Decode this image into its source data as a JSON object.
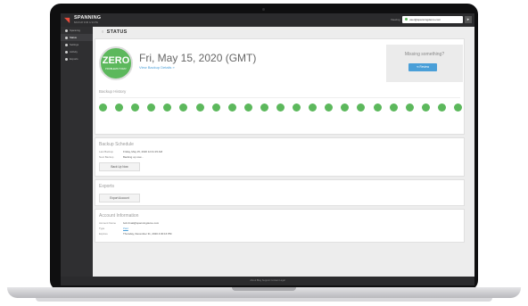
{
  "app": {
    "brand": "SPANNING",
    "brand_sub": "BACKUP FOR G SUITE",
    "account_label": "Viewing",
    "account_value": "user@spanningdemo.com"
  },
  "sidebar": {
    "items": [
      {
        "label": "Spanning",
        "active": false
      },
      {
        "label": "Status",
        "active": true
      },
      {
        "label": "Settings",
        "active": false
      },
      {
        "label": "Activity",
        "active": false
      },
      {
        "label": "Exports",
        "active": false
      }
    ]
  },
  "page": {
    "title": "STATUS"
  },
  "status": {
    "badge_main": "ZERO",
    "badge_sub": "PROBLEMS TODAY",
    "date": "Fri, May 15, 2020 (GMT)",
    "link": "View Backup Details »",
    "missing": "Missing something?",
    "review_label": "Review",
    "history_label": "Backup History",
    "history_days": 23,
    "history_color": "#5cb85c"
  },
  "schedule": {
    "title": "Backup Schedule",
    "last_label": "Last Backup",
    "last_value": "Friday, May 15, 2020 12:41:15 AM",
    "next_label": "Next Backup",
    "next_value": "Backing up now...",
    "back_up_now": "Back Up Now"
  },
  "exports": {
    "title": "Exports",
    "export_account": "Export Account"
  },
  "account": {
    "title": "Account Information",
    "name_label": "Account Name",
    "name_value": "bob.fmatt@spanningdemo.com",
    "type_label": "Type",
    "type_value": "Paid",
    "expires_label": "Expires",
    "expires_value": "Thursday, December 31, 2020 4:30:16 PM"
  },
  "footer": {
    "text": "About   Blog   Support   Contact   Legal"
  },
  "colors": {
    "accent": "#4a9fd8",
    "success": "#5cb85c",
    "topbar": "#2b2b2d"
  }
}
